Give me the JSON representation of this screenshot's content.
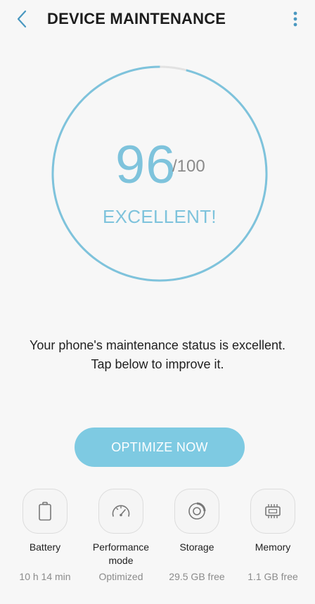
{
  "header": {
    "title": "DEVICE MAINTENANCE"
  },
  "score": {
    "value": "96",
    "max": "/100",
    "status": "EXCELLENT!",
    "fraction": 0.96
  },
  "message": {
    "line1": "Your phone's maintenance status is excellent.",
    "line2": "Tap below to improve it."
  },
  "actions": {
    "optimize_label": "OPTIMIZE NOW"
  },
  "tiles": [
    {
      "label": "Battery",
      "value": "10 h 14 min",
      "icon": "battery-icon"
    },
    {
      "label": "Performance mode",
      "value": "Optimized",
      "icon": "gauge-icon"
    },
    {
      "label": "Storage",
      "value": "29.5 GB free",
      "icon": "storage-disc-icon"
    },
    {
      "label": "Memory",
      "value": "1.1 GB free",
      "icon": "memory-chip-icon"
    }
  ],
  "colors": {
    "accent": "#7ec3dc",
    "button": "#7ecae2",
    "track": "#e2e2e2"
  }
}
